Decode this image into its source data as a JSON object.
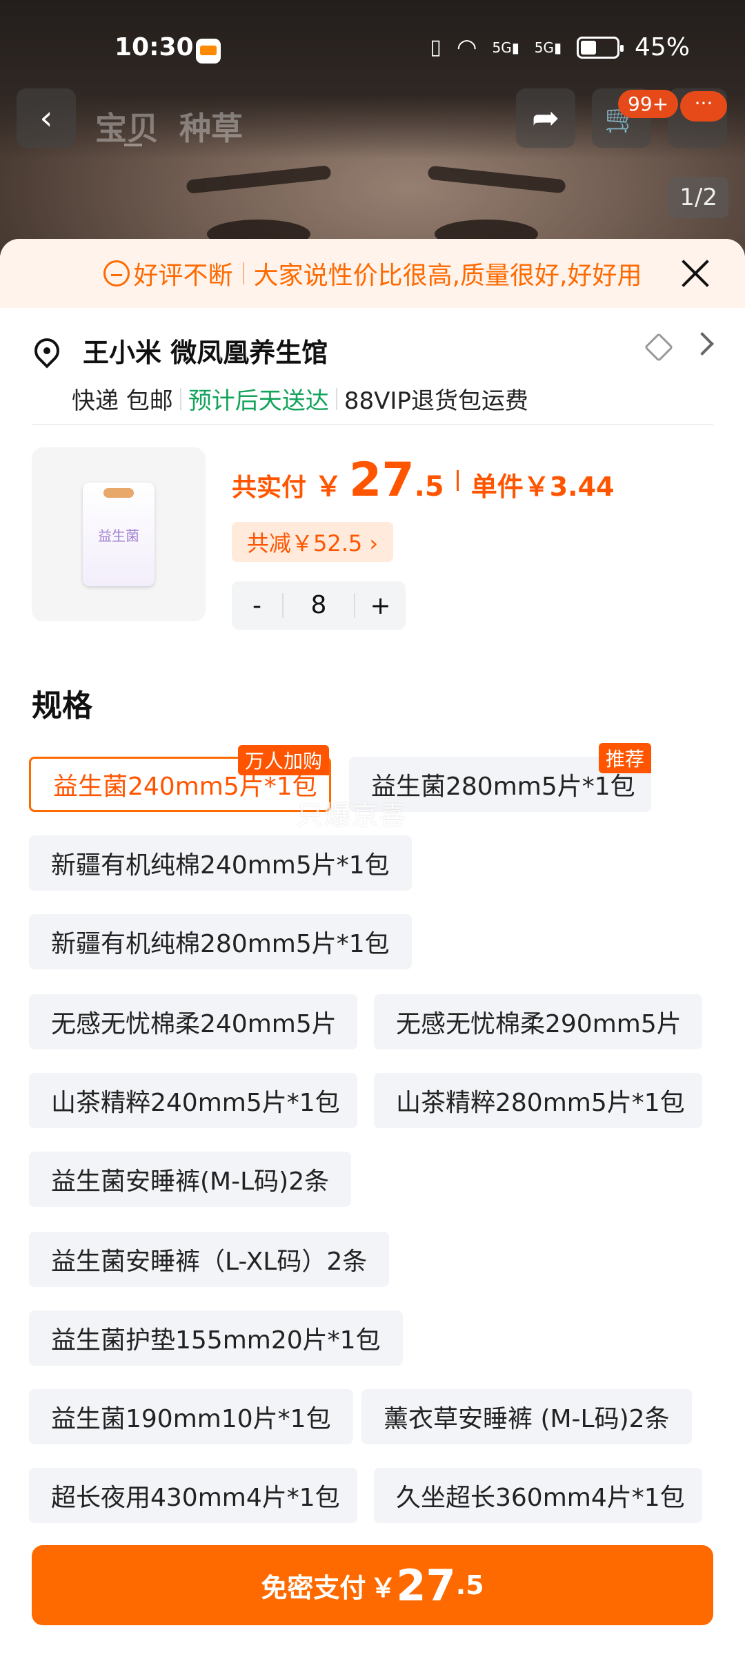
{
  "status_bar": {
    "time": "10:30",
    "battery": "45%",
    "net1": "5G",
    "net2": "5G"
  },
  "nav": {
    "tab1": "宝贝",
    "tab2": "种草",
    "cart_badge": "99+",
    "more_badge": "···",
    "page_indicator": "1/2"
  },
  "promo": {
    "label": "好评不断",
    "text": "大家说性价比很高,质量很好,好好用"
  },
  "address": {
    "name": "王小米 微凤凰养生馆",
    "delivery": "快递 包邮",
    "eta": "预计后天送达",
    "return": "88VIP退货包运费"
  },
  "product": {
    "price_label": "共实付",
    "currency": "￥",
    "price_int": "27",
    "price_dec": ".5",
    "unit_price": "单件￥3.44",
    "discount": "共减￥52.5 ›",
    "qty_minus": "-",
    "qty": "8",
    "qty_plus": "+",
    "pack_label": "益生菌"
  },
  "specs": {
    "title": "规格",
    "tag_hot": "万人加购",
    "tag_rec": "推荐",
    "items": [
      "益生菌240mm5片*1包",
      "益生菌280mm5片*1包",
      "新疆有机纯棉240mm5片*1包",
      "新疆有机纯棉280mm5片*1包",
      "无感无忧棉柔240mm5片",
      "无感无忧棉柔290mm5片",
      "山茶精粹240mm5片*1包",
      "山茶精粹280mm5片*1包",
      "益生菌安睡裤(M-L码)2条",
      "益生菌安睡裤（L-XL码）2条",
      "益生菌护垫155mm20片*1包",
      "益生菌190mm10片*1包",
      "薰衣草安睡裤 (M-L码)2条",
      "超长夜用430mm4片*1包",
      "久坐超长360mm4片*1包"
    ],
    "selected": "益生菌240mm5片*1包"
  },
  "watermark": "只爆京喜",
  "pay": {
    "label": "免密支付",
    "currency": "￥",
    "amount_int": "27",
    "amount_dec": ".5"
  },
  "colors": {
    "accent": "#ff6a00",
    "price": "#ff5500",
    "green": "#12a35a"
  }
}
